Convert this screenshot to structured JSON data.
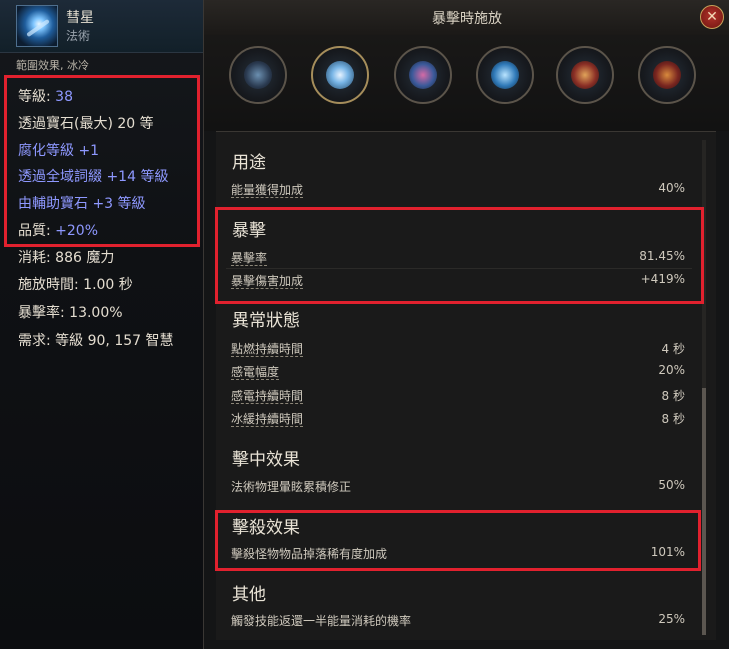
{
  "left_panel": {
    "skill_name": "彗星",
    "skill_type": "法術",
    "tags": "範圍效果, 冰冷",
    "level_label": "等級: ",
    "level_value": "38",
    "stats": [
      "透過寶石(最大) 20 等",
      "腐化等級 +1",
      "透過全域詞綴 +14 等級",
      "由輔助寶石 +3 等級"
    ],
    "quality_label": "品質: ",
    "quality_value": "+20%",
    "cost": "消耗: 886 魔力",
    "cast_time_label": "施放時間: ",
    "cast_time_value": "1.00 秒",
    "crit_label": "暴擊率: ",
    "crit_value": "13.00%",
    "requirement": "需求: 等級 90, 157 智慧"
  },
  "right_panel": {
    "title": "暴擊時施放",
    "close_label": "✕",
    "gems": [
      "gem-1",
      "gem-2",
      "gem-3",
      "gem-4",
      "gem-5",
      "gem-6"
    ],
    "sections": {
      "usage": {
        "title": "用途",
        "rows": [
          {
            "label": "能量獲得加成",
            "value": "40%"
          }
        ]
      },
      "crit": {
        "title": "暴擊",
        "rows": [
          {
            "label": "暴擊率",
            "value": "81.45%"
          },
          {
            "label": "暴擊傷害加成",
            "value": "+419%"
          }
        ]
      },
      "ailment": {
        "title": "異常狀態",
        "rows": [
          {
            "label": "點燃持續時間",
            "value": "4 秒"
          },
          {
            "label": "感電幅度",
            "value": "20%"
          },
          {
            "label": "感電持續時間",
            "value": "8 秒"
          },
          {
            "label": "冰緩持續時間",
            "value": "8 秒"
          }
        ]
      },
      "on_hit": {
        "title": "擊中效果",
        "rows": [
          {
            "label": "法術物理暈眩累積修正",
            "value": "50%"
          }
        ]
      },
      "on_kill": {
        "title": "擊殺效果",
        "rows": [
          {
            "label": "擊殺怪物物品掉落稀有度加成",
            "value": "101%"
          }
        ]
      },
      "other": {
        "title": "其他",
        "rows": [
          {
            "label": "觸發技能返還一半能量消耗的機率",
            "value": "25%"
          }
        ]
      }
    }
  },
  "colors": {
    "highlight": "#e1212e",
    "magic_blue": "#8e98ff",
    "text": "#d7d2c8"
  }
}
